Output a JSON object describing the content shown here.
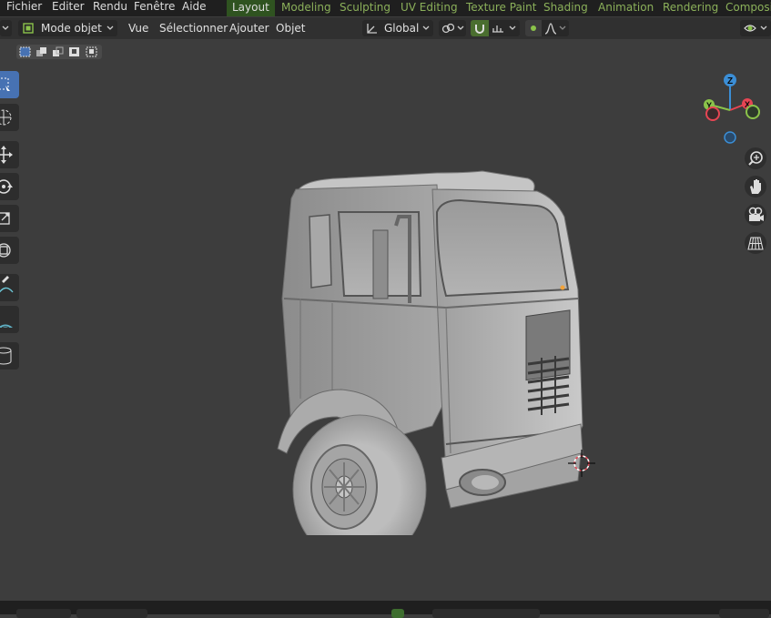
{
  "menubar": {
    "items": [
      "Fichier",
      "Editer",
      "Rendu",
      "Fenêtre",
      "Aide"
    ],
    "workspaces": [
      "Layout",
      "Modeling",
      "Sculpting",
      "UV Editing",
      "Texture Paint",
      "Shading",
      "Animation",
      "Rendering",
      "Compositi"
    ],
    "active_workspace": "Layout"
  },
  "header": {
    "mode": "Mode objet",
    "menus": [
      "Vue",
      "Sélectionner",
      "Ajouter",
      "Objet"
    ],
    "orientation": "Global"
  },
  "gizmo": {
    "axis_z": "Z",
    "axis_y": "Y",
    "axis_x": "X"
  },
  "tools": [
    "select-box",
    "cursor",
    "move",
    "rotate",
    "scale",
    "transform",
    "annotate",
    "measure",
    "add-cube"
  ],
  "nav_buttons": [
    "zoom-icon",
    "hand-pan-icon",
    "camera-icon",
    "grid-icon"
  ],
  "colors": {
    "active_tool": "#4772b3",
    "active_workspace": "#2f5320",
    "workspace_text": "#8bb05a",
    "viewport_bg": "#3d3d3d",
    "axis_x": "#e64553",
    "axis_y": "#8bc34a",
    "axis_z": "#3b8ed6"
  }
}
